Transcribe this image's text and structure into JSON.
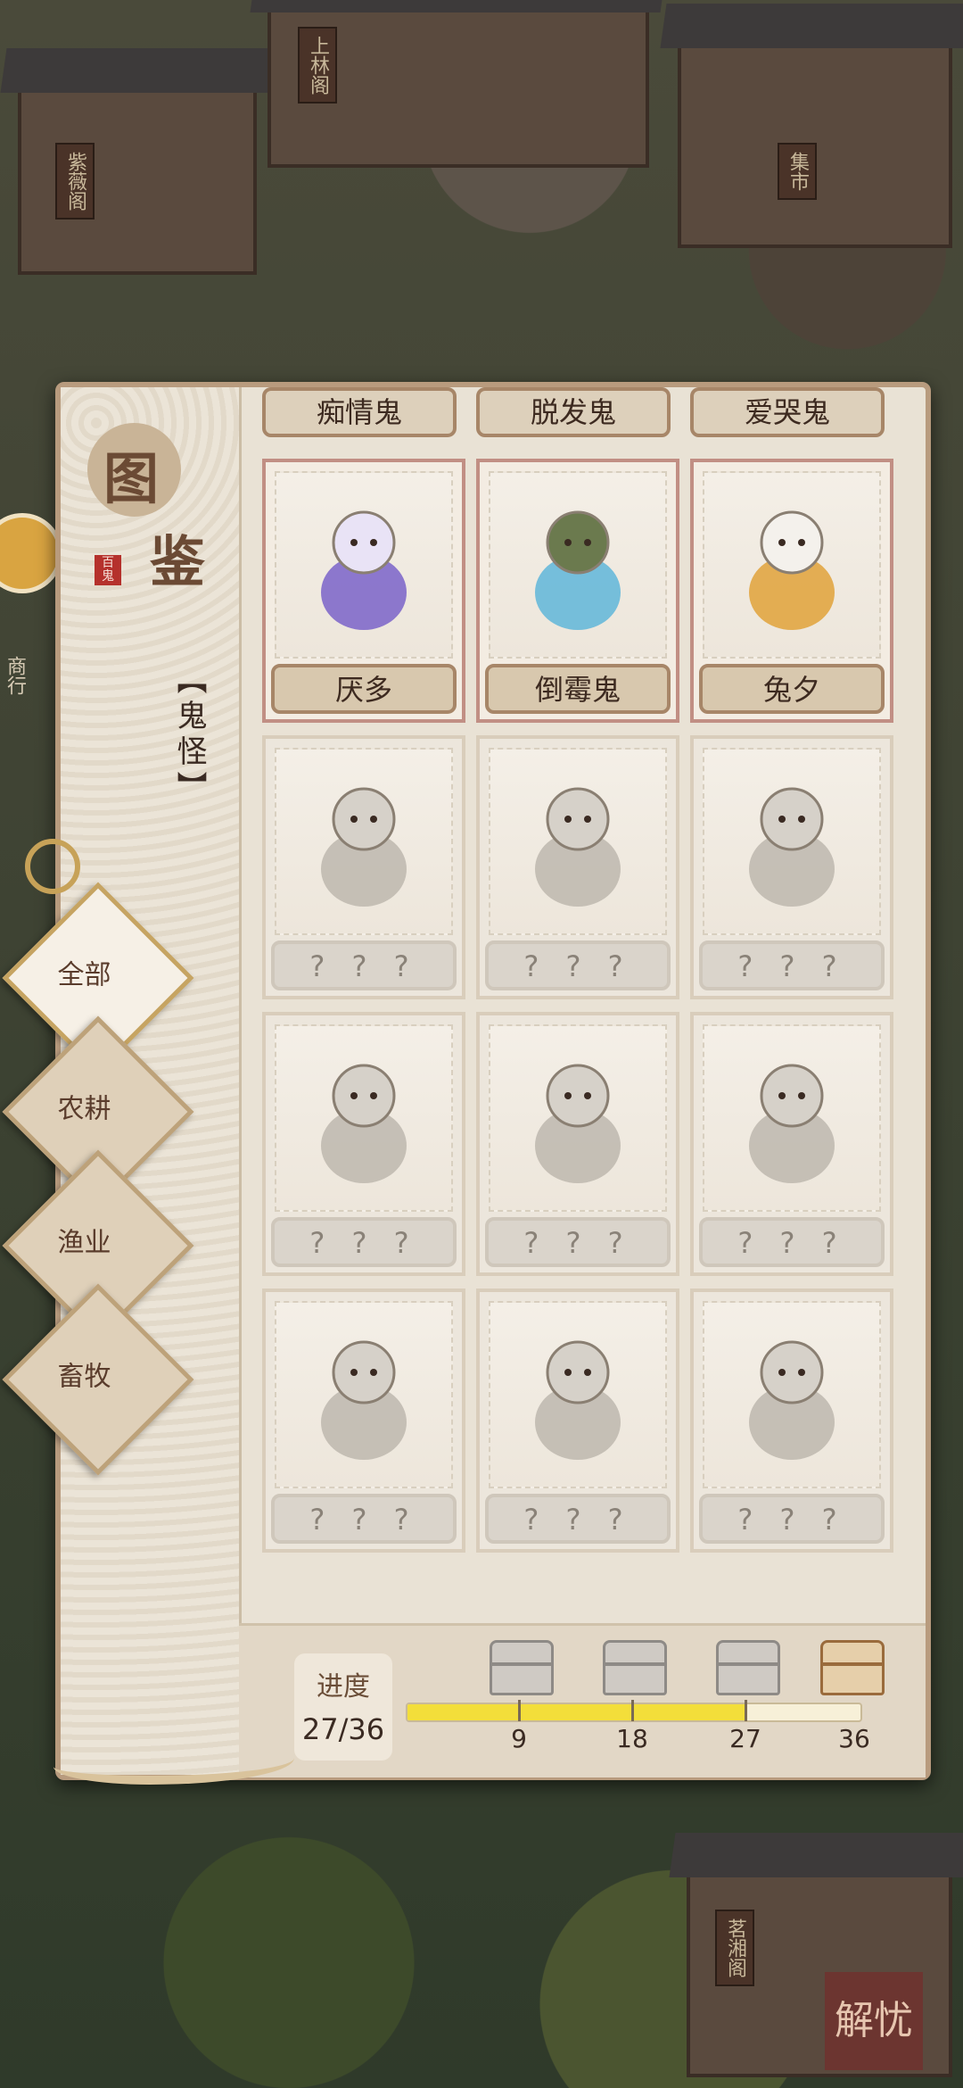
{
  "background": {
    "signs": [
      "紫薇阁",
      "上林阁",
      "集市",
      "茗湘阁"
    ],
    "side_label": "商行",
    "corner_logo": "解忧"
  },
  "panel": {
    "logo_chars": [
      "图",
      "鉴"
    ],
    "logo_seal": "百鬼",
    "category_title": "【鬼怪】",
    "filters": [
      "全部",
      "农耕",
      "渔业",
      "畜牧"
    ],
    "active_filter": "全部",
    "top_row_labels": [
      "痴情鬼",
      "脱发鬼",
      "爱哭鬼"
    ],
    "cards": [
      {
        "name": "厌多",
        "unlocked": true,
        "icon": "ghost-lady-icon"
      },
      {
        "name": "倒霉鬼",
        "unlocked": true,
        "icon": "ghost-hooded-icon"
      },
      {
        "name": "兔夕",
        "unlocked": true,
        "icon": "rabbit-ghost-icon"
      },
      {
        "name": "? ? ?",
        "unlocked": false,
        "icon": "snail-ghost-icon"
      },
      {
        "name": "? ? ?",
        "unlocked": false,
        "icon": "lion-mask-icon"
      },
      {
        "name": "? ? ?",
        "unlocked": false,
        "icon": "fan-ghost-icon"
      },
      {
        "name": "? ? ?",
        "unlocked": false,
        "icon": "monk-staff-icon"
      },
      {
        "name": "? ? ?",
        "unlocked": false,
        "icon": "spoon-ghost-icon"
      },
      {
        "name": "? ? ?",
        "unlocked": false,
        "icon": "umbrella-ghost-icon"
      },
      {
        "name": "? ? ?",
        "unlocked": false,
        "icon": "food-ghost-icon"
      },
      {
        "name": "? ? ?",
        "unlocked": false,
        "icon": "fisher-hat-icon"
      },
      {
        "name": "? ? ?",
        "unlocked": false,
        "icon": "rider-ghost-icon"
      }
    ]
  },
  "progress": {
    "label": "进度",
    "value_text": "27/36",
    "current": 27,
    "total": 36,
    "milestones": [
      9,
      18,
      27,
      36
    ],
    "milestone_labels": [
      "9",
      "18",
      "27",
      "36"
    ]
  },
  "colors": {
    "accent": "#a78668",
    "progress_fill": "#f3de3a",
    "seal_red": "#b5312c"
  }
}
